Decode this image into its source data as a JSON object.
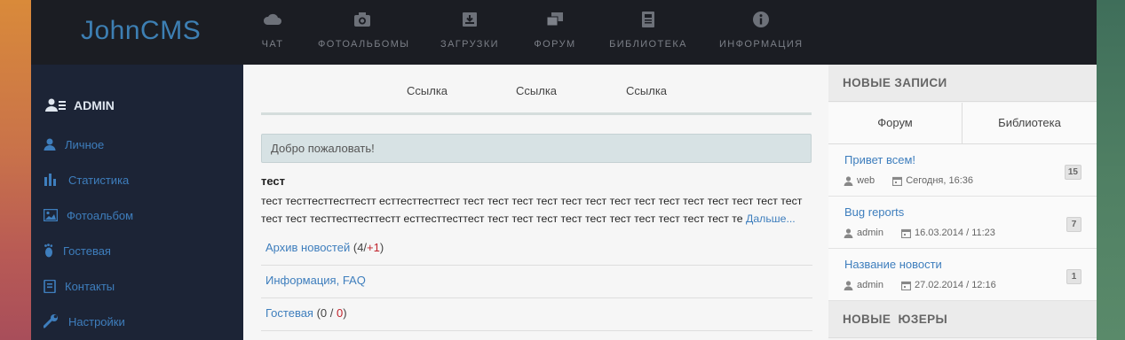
{
  "brand": {
    "name": "JohnCMS"
  },
  "topnav": [
    {
      "label": "ЧАТ",
      "icon": "cloud-icon"
    },
    {
      "label": "ФОТОАЛЬБОМЫ",
      "icon": "camera-icon"
    },
    {
      "label": "ЗАГРУЗКИ",
      "icon": "download-box-icon"
    },
    {
      "label": "ФОРУМ",
      "icon": "comments-icon"
    },
    {
      "label": "БИБЛИОТЕКА",
      "icon": "book-icon"
    },
    {
      "label": "ИНФОРМАЦИЯ",
      "icon": "info-icon"
    }
  ],
  "sidebar": {
    "user": "ADMIN",
    "items": [
      {
        "label": "Личное",
        "icon": "user-icon"
      },
      {
        "label": "Статистика",
        "icon": "bar-chart-icon"
      },
      {
        "label": "Фотоальбом",
        "icon": "picture-icon"
      },
      {
        "label": "Гостевая",
        "icon": "footprint-icon"
      },
      {
        "label": "Контакты",
        "icon": "contacts-book-icon"
      },
      {
        "label": "Настройки",
        "icon": "wrench-icon"
      }
    ]
  },
  "main": {
    "links": [
      "Ссылка",
      "Ссылка",
      "Ссылка"
    ],
    "welcome": "Добро пожаловать!",
    "news": {
      "title": "тест",
      "line1": "тест тесттесттесттестт ecттесттесттест тест тест тест тест тест тест тест тест тест тест тест тест тест тест",
      "line2": "тест тест тесттесттесттестт ecттесттесттест тест тест тест тест тест тест тест тест тест тест те",
      "more": "Дальше..."
    },
    "list": [
      {
        "label": "Архив новостей",
        "open": " (",
        "count": "4",
        "sep": "/",
        "new": "+1",
        "close": ")"
      },
      {
        "label": "Информация, FAQ"
      },
      {
        "label": "Гостевая",
        "open": " (",
        "count": "0",
        "sep": " / ",
        "new": "0",
        "close": ")"
      }
    ]
  },
  "right": {
    "new_posts_header": "НОВЫЕ ЗАПИСИ",
    "tabs": [
      "Форум",
      "Библиотека"
    ],
    "posts": [
      {
        "title": "Привет всем!",
        "author": "web",
        "date": "Сегодня, 16:36",
        "count": "15"
      },
      {
        "title": "Bug reports",
        "author": "admin",
        "date": "16.03.2014 / 11:23",
        "count": "7"
      },
      {
        "title": "Название новости",
        "author": "admin",
        "date": "27.02.2014 / 12:16",
        "count": "1"
      }
    ],
    "new_users_header": "НОВЫЕ  ЮЗЕРЫ"
  },
  "colors": {
    "topbar": "#1b1d23",
    "sidebar": "#1c2436",
    "link": "#3e7ebd",
    "accent_red": "#c0232c"
  }
}
